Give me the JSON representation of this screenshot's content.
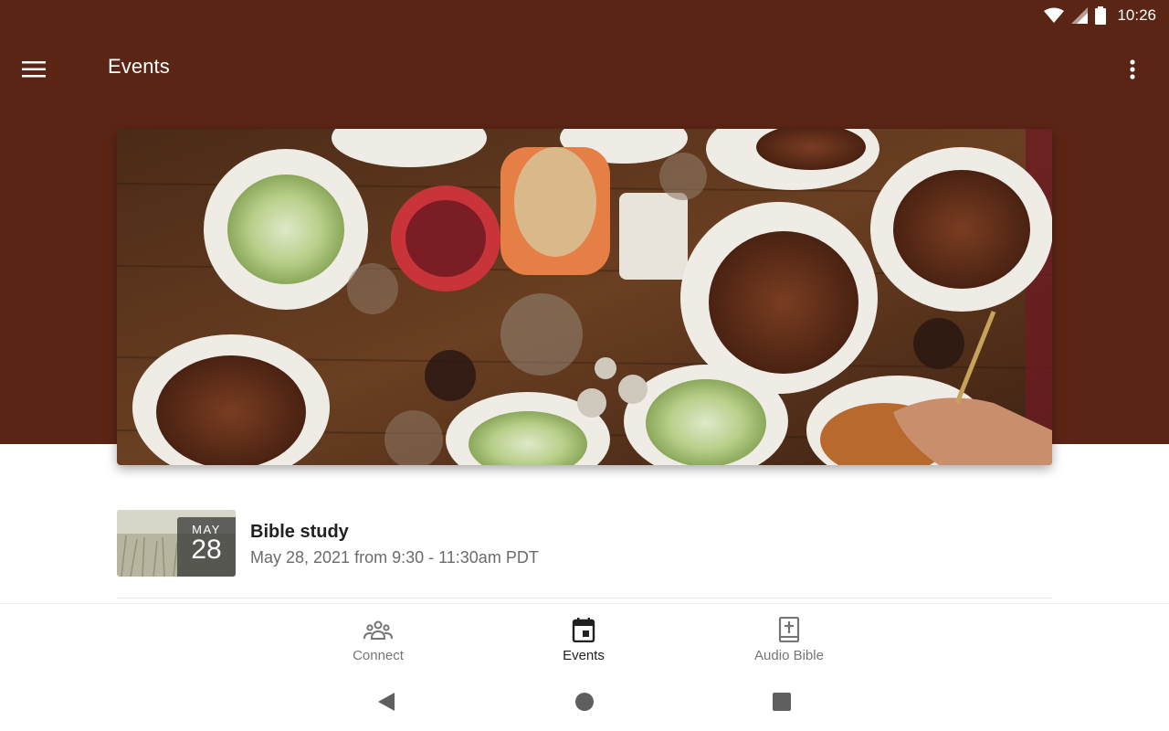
{
  "status_bar": {
    "time": "10:26"
  },
  "toolbar": {
    "title": "Events"
  },
  "events": [
    {
      "title": "Bible study",
      "date_text": "May 28, 2021 from 9:30 - 11:30am PDT",
      "badge_month": "MAY",
      "badge_day": "28"
    }
  ],
  "bottom_nav": {
    "items": [
      {
        "label": "Connect",
        "icon": "people-group-icon",
        "active": false
      },
      {
        "label": "Events",
        "icon": "calendar-icon",
        "active": true
      },
      {
        "label": "Audio Bible",
        "icon": "bible-icon",
        "active": false
      }
    ]
  },
  "colors": {
    "header_brown": "#5b2515",
    "active_text": "#212121",
    "inactive_text": "#757575"
  }
}
